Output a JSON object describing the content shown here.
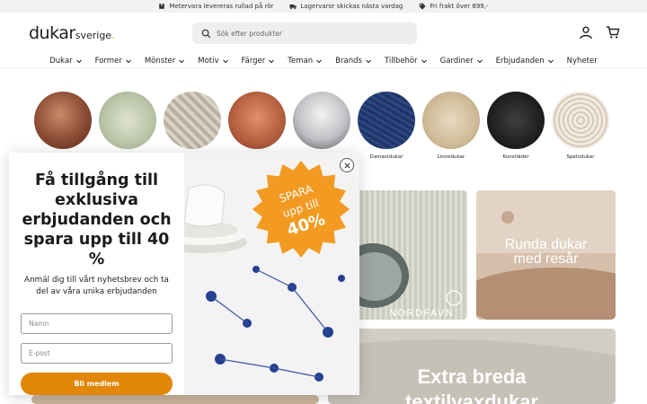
{
  "topbar": {
    "items": [
      {
        "label": "Metervara levereras rullad på rör",
        "icon": "package-icon"
      },
      {
        "label": "Lagervaror skickas nästa vardag",
        "icon": "truck-icon"
      },
      {
        "label": "Fri frakt över 899,-",
        "icon": "tag-icon"
      }
    ]
  },
  "header": {
    "logo_main": "dukar",
    "logo_sub": "sverige",
    "logo_dot": ".",
    "search_placeholder": "Sök efter produkter"
  },
  "nav": {
    "items": [
      "Dukar",
      "Former",
      "Mönster",
      "Motiv",
      "Färger",
      "Teman",
      "Brands",
      "Tillbehör",
      "Gardiner",
      "Erbjudanden",
      "Nyheter"
    ]
  },
  "categories": [
    {
      "label": ""
    },
    {
      "label": ""
    },
    {
      "label": ""
    },
    {
      "label": ""
    },
    {
      "label": ""
    },
    {
      "label": "Damastdukar"
    },
    {
      "label": "Linnedukar"
    },
    {
      "label": "Konstläder"
    },
    {
      "label": "Spetsdukar"
    }
  ],
  "tiles": {
    "nordfavn_label": "NORDFAVN",
    "round_line1": "Runda dukar",
    "round_line2": "med resår",
    "wide_line1": "Extra breda",
    "wide_line2": "textilvaxdukar"
  },
  "popup": {
    "title": "Få tillgång till exklusiva erbjudanden och spara upp till 40 %",
    "subtitle": "Anmäl dig till vårt nyhetsbrev och ta del av våra unika erbjudanden",
    "name_placeholder": "Namn",
    "email_placeholder": "E-post",
    "button_label": "Bli medlem",
    "badge_line1": "SPARA",
    "badge_line2": "upp till",
    "badge_line3": "40%"
  },
  "colors": {
    "accent": "#e2860a",
    "logo_dot": "#e8a200",
    "badge": "#f29a22"
  }
}
